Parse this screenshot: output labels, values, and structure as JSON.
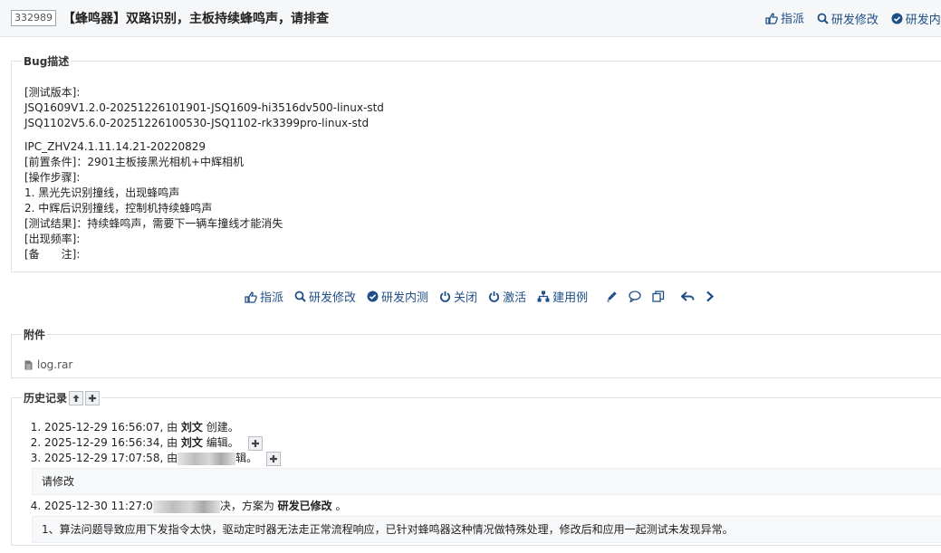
{
  "header": {
    "bug_id": "332989",
    "title": "【蜂鸣器】双路识别，主板持续蜂鸣声，请排查",
    "actions": [
      "指派",
      "研发修改",
      "研发内测"
    ]
  },
  "description": {
    "legend": "Bug描述",
    "lines_top": [
      "[测试版本]:",
      "JSQ1609V1.2.0-20251226101901-JSQ1609-hi3516dv500-linux-std",
      "JSQ1102V5.6.0-20251226100530-JSQ1102-rk3399pro-linux-std"
    ],
    "lines_bottom": [
      "IPC_ZHV24.1.11.14.21-20220829",
      "[前置条件]：2901主板接黑光相机+中辉相机",
      "[操作步骤]:",
      "1. 黑光先识别撞线，出现蜂鸣声",
      "2. 中辉后识别撞线，控制机持续蜂鸣声",
      "[测试结果]：持续蜂鸣声，需要下一辆车撞线才能消失",
      "[出现频率]:",
      "[备　　注]:"
    ]
  },
  "actions": {
    "assign": "指派",
    "dev_modify": "研发修改",
    "dev_test": "研发内测",
    "close": "关闭",
    "activate": "激活",
    "create_case": "建用例"
  },
  "attachments": {
    "legend": "附件",
    "files": [
      "log.rar"
    ]
  },
  "history": {
    "legend": "历史记录",
    "items": [
      {
        "time": "2025-12-29 16:56:07",
        "by": ", 由 ",
        "user": "刘文",
        "action": " 创建。"
      },
      {
        "time": "2025-12-29 16:56:34",
        "by": ", 由 ",
        "user": "刘文",
        "action": " 编辑。"
      },
      {
        "time": "2025-12-29 17:07:58",
        "by": ", 由",
        "tail": "辑。",
        "comment": "请修改"
      },
      {
        "time": "2025-12-30 11:27:0",
        "tail": "决，方案为 ",
        "solution": "研发已修改",
        "end": " 。",
        "comment": "1、算法问题导致应用下发指令太快，驱动定时器无法走正常流程响应，已针对蜂鸣器这种情况做特殊处理，修改后和应用一起测试未发现异常。"
      }
    ]
  }
}
